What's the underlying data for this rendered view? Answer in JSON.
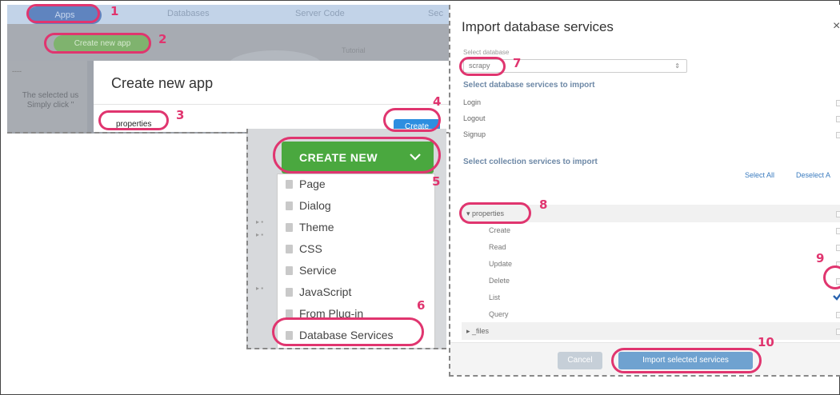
{
  "panel1": {
    "tabs": [
      "Apps",
      "Databases",
      "Server Code",
      "Sec"
    ],
    "create_new_app_button": "Create new app",
    "tutorial_label": "Tutorial",
    "left_dash": "----",
    "left_text_line1": "The selected us",
    "left_text_line2": "Simply click \"",
    "dialog_title": "Create new app",
    "app_name_value": "properties",
    "create_button": "Create"
  },
  "panel2": {
    "create_new_label": "CREATE NEW",
    "menu_items": [
      "Page",
      "Dialog",
      "Theme",
      "CSS",
      "Service",
      "JavaScript",
      "From Plug-in",
      "Database Services"
    ]
  },
  "panel3": {
    "title": "Import database services",
    "close": "×",
    "select_database_label": "Select database",
    "database_value": "scrapy",
    "database_services_heading": "Select database services to import",
    "database_services": [
      "Login",
      "Logout",
      "Signup"
    ],
    "collection_services_heading": "Select collection services to import",
    "select_all": "Select All",
    "deselect_all": "Deselect A",
    "collection_name": "properties",
    "collection_ops": [
      "Create",
      "Read",
      "Update",
      "Delete",
      "List",
      "Query"
    ],
    "checked_op": "List",
    "files_collection": "_files",
    "cancel_button": "Cancel",
    "import_button": "Import selected services"
  },
  "callouts": [
    "1",
    "2",
    "3",
    "4",
    "5",
    "6",
    "7",
    "8",
    "9",
    "10"
  ],
  "colors": {
    "callout": "#e0356f",
    "create_new_green": "#4aa83f",
    "create_blue": "#2d8ee0",
    "import_blue": "#6fa2d0"
  }
}
